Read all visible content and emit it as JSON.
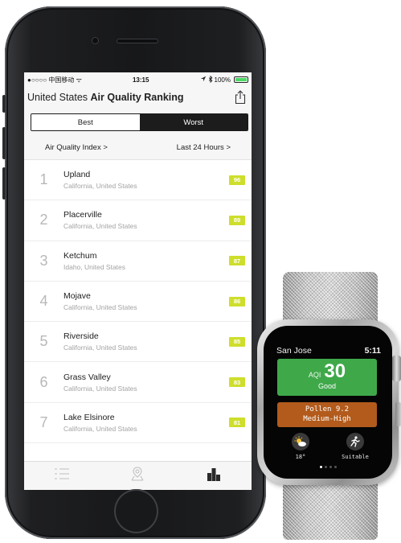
{
  "phone": {
    "status_bar": {
      "carrier": "●○○○○ 中国移动 ᯤ",
      "time": "13:15",
      "battery": "100%"
    },
    "nav": {
      "country": "United States",
      "title": "Air Quality Ranking"
    },
    "segment": {
      "best": "Best",
      "worst": "Worst",
      "selected": "Worst"
    },
    "filters": {
      "metric": "Air Quality Index >",
      "period": "Last 24 Hours >"
    },
    "rankings": [
      {
        "rank": "1",
        "city": "Upland",
        "region": "California, United States",
        "aqi": "96"
      },
      {
        "rank": "2",
        "city": "Placerville",
        "region": "California, United States",
        "aqi": "89"
      },
      {
        "rank": "3",
        "city": "Ketchum",
        "region": "Idaho, United States",
        "aqi": "87"
      },
      {
        "rank": "4",
        "city": "Mojave",
        "region": "California, United States",
        "aqi": "86"
      },
      {
        "rank": "5",
        "city": "Riverside",
        "region": "California, United States",
        "aqi": "85"
      },
      {
        "rank": "6",
        "city": "Grass Valley",
        "region": "California, United States",
        "aqi": "83"
      },
      {
        "rank": "7",
        "city": "Lake Elsinore",
        "region": "California, United States",
        "aqi": "81"
      }
    ],
    "tabs": [
      {
        "icon": "list-icon",
        "selected": false
      },
      {
        "icon": "map-pin-icon",
        "selected": false
      },
      {
        "icon": "ranking-icon",
        "selected": true
      }
    ],
    "colors": {
      "aqi_badge": "#cede2c",
      "segment_dark": "#1c1c1c"
    }
  },
  "watch": {
    "city": "San Jose",
    "time": "5:11",
    "aqi_label": "AQI",
    "aqi_value": "30",
    "aqi_status": "Good",
    "pollen_line": "Pollen 9.2",
    "pollen_level": "Medium-High",
    "temperature": "18°",
    "activity": "Suitable",
    "weather_icon": "sun-cloud-icon",
    "activity_icon": "running-icon",
    "colors": {
      "aqi_card": "#3fa94a",
      "pollen_card": "#b25b1c"
    }
  }
}
